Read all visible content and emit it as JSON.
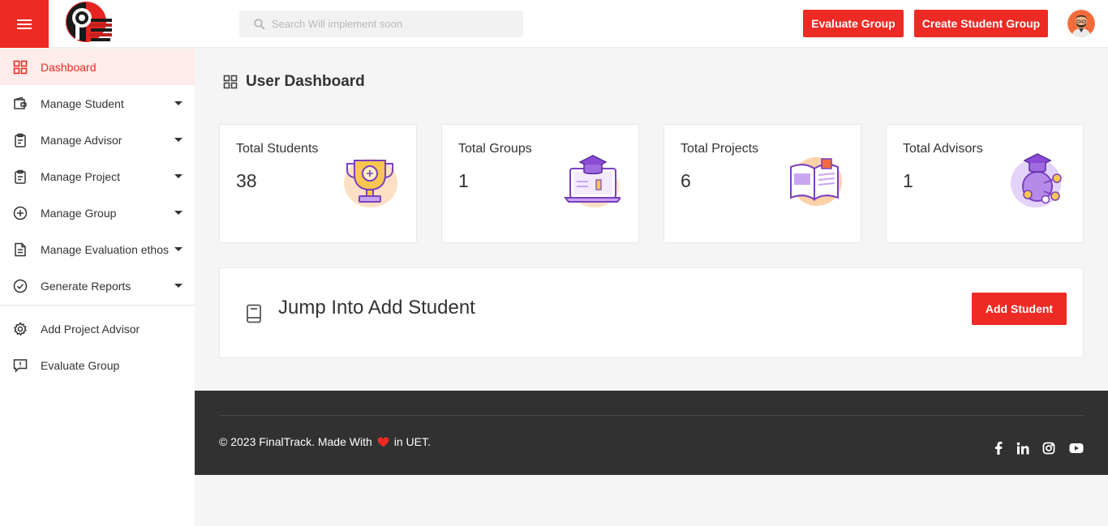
{
  "header": {
    "search_placeholder": "Search Will implement soon",
    "evaluate_label": "Evaluate Group",
    "create_label": "Create Student Group"
  },
  "sidebar": {
    "items": [
      {
        "label": "Dashboard",
        "icon": "grid-icon",
        "active": true
      },
      {
        "label": "Manage Student",
        "icon": "wallet-icon",
        "dropdown": true
      },
      {
        "label": "Manage Advisor",
        "icon": "clipboard-icon",
        "dropdown": true
      },
      {
        "label": "Manage Project",
        "icon": "clipboard-icon",
        "dropdown": true
      },
      {
        "label": "Manage Group",
        "icon": "plus-circle-icon",
        "dropdown": true
      },
      {
        "label": "Manage Evaluation ethos",
        "icon": "document-icon",
        "dropdown": true
      },
      {
        "label": "Generate Reports",
        "icon": "check-circle-icon",
        "dropdown": true
      },
      {
        "label": "Add Project Advisor",
        "icon": "gear-icon"
      },
      {
        "label": "Evaluate Group",
        "icon": "alert-message-icon"
      }
    ]
  },
  "main": {
    "title": "User Dashboard",
    "stats": [
      {
        "label": "Total Students",
        "value": "38",
        "icon": "trophy-icon"
      },
      {
        "label": "Total Groups",
        "value": "1",
        "icon": "laptop-graduation-icon"
      },
      {
        "label": "Total Projects",
        "value": "6",
        "icon": "open-book-icon"
      },
      {
        "label": "Total Advisors",
        "value": "1",
        "icon": "graduation-network-icon"
      }
    ],
    "jump": {
      "title": "Jump Into Add Student",
      "button_label": "Add Student"
    }
  },
  "footer": {
    "copy_before": "© 2023 FinalTrack. Made With",
    "copy_after": "in UET.",
    "social": [
      "facebook-icon",
      "linkedin-icon",
      "instagram-icon",
      "youtube-icon"
    ]
  },
  "colors": {
    "accent": "#ee2a24",
    "footer_bg": "#313131",
    "active_bg": "#fdecea"
  }
}
